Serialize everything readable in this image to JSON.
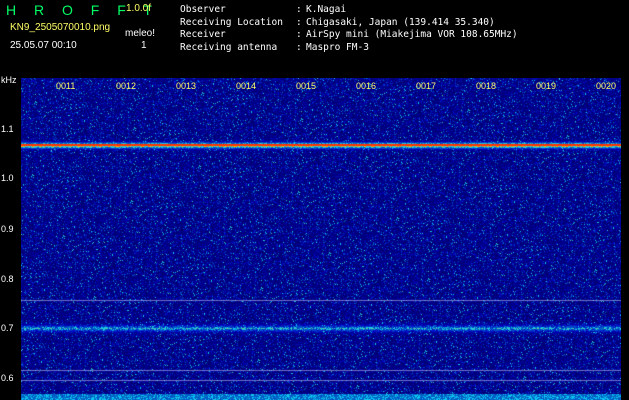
{
  "header": {
    "title": "H R O F F T",
    "version": "1.0.0f",
    "filename": "KN9_2505070010.png",
    "signal_label": "meleo!",
    "datetime": "25.05.07 00:10",
    "count": "1",
    "info": [
      {
        "key": "Observer",
        "value": "K.Nagai"
      },
      {
        "key": "Receiving Location",
        "value": "Chigasaki, Japan (139.414 35.340)"
      },
      {
        "key": "Receiver",
        "value": "AirSpy mini (Miakejima VOR 108.65MHz)"
      },
      {
        "key": "Receiving antenna",
        "value": "Maspro FM-3"
      }
    ]
  },
  "spectrogram": {
    "y_unit": "kHz",
    "y_labels": [
      "1.1",
      "1.0",
      "0.9",
      "0.8",
      "0.7",
      "0.6"
    ],
    "time_labels": [
      "0011",
      "0012",
      "0013",
      "0014",
      "0015",
      "0016",
      "0017",
      "0018",
      "0019",
      "0020"
    ],
    "colors": {
      "background": "#00007a",
      "title": "#00ff66",
      "label_yellow": "#ffff66",
      "carrier": "#ff3300"
    }
  }
}
